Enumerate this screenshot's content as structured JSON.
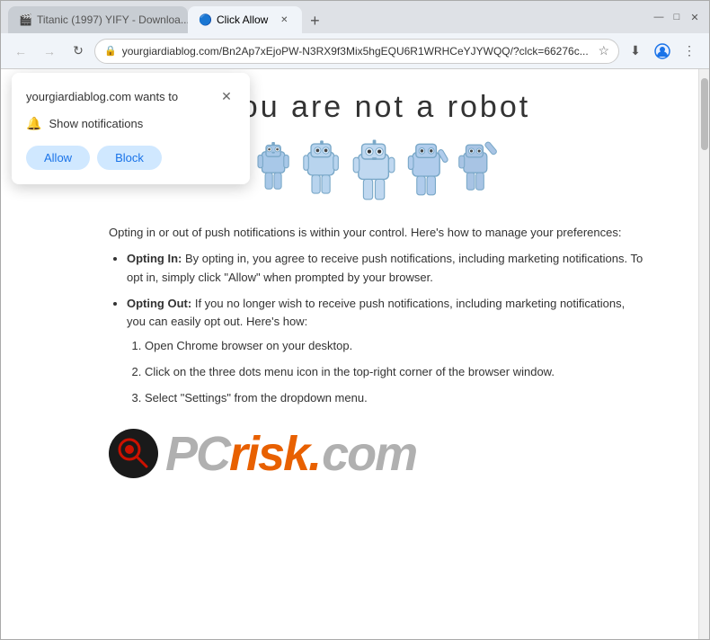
{
  "browser": {
    "tabs": [
      {
        "id": "tab1",
        "label": "Titanic (1997) YIFY - Downloa...",
        "active": false,
        "favicon": "🎬"
      },
      {
        "id": "tab2",
        "label": "Click Allow",
        "active": true,
        "favicon": "🔵"
      }
    ],
    "new_tab_label": "+",
    "window_controls": {
      "minimize": "—",
      "maximize": "□",
      "close": "✕"
    }
  },
  "address_bar": {
    "back_btn": "←",
    "forward_btn": "→",
    "refresh_btn": "↻",
    "url": "yourgiardiablog.com/Bn2Ap7xEjoPW-N3RX9f3Mix5hgEQU6R1WRHCeYJYWQQ/?clck=66276c...",
    "star_icon": "☆",
    "download_icon": "⬇",
    "profile_icon": "👤",
    "menu_icon": "⋮"
  },
  "notification_popup": {
    "title": "yourgiardiablog.com wants to",
    "close_btn": "✕",
    "notification_icon": "🔔",
    "notification_text": "Show notifications",
    "allow_label": "Allow",
    "block_label": "Block"
  },
  "page": {
    "robot_verification_text": "you are not   a robot",
    "robots_count": 5,
    "body_paragraph": "Opting in or out of push notifications is within your control. Here's how to manage your preferences:",
    "bullet_points": [
      {
        "bold_part": "Opting In:",
        "text": " By opting in, you agree to receive push notifications, including marketing notifications. To opt in, simply click \"Allow\" when prompted by your browser."
      },
      {
        "bold_part": "Opting Out:",
        "text": " If you no longer wish to receive push notifications, including marketing notifications, you can easily opt out. Here's how:"
      }
    ],
    "numbered_list": [
      "Open Chrome browser on your desktop.",
      "Click on the three dots menu icon in the top-right corner of the browser window.",
      "Select \"Settings\" from the dropdown menu."
    ],
    "logo": {
      "text_pc": "PC",
      "text_risk": "risk",
      "text_dot": ".",
      "text_com": "com",
      "magnifier_color": "#cc1100"
    }
  }
}
